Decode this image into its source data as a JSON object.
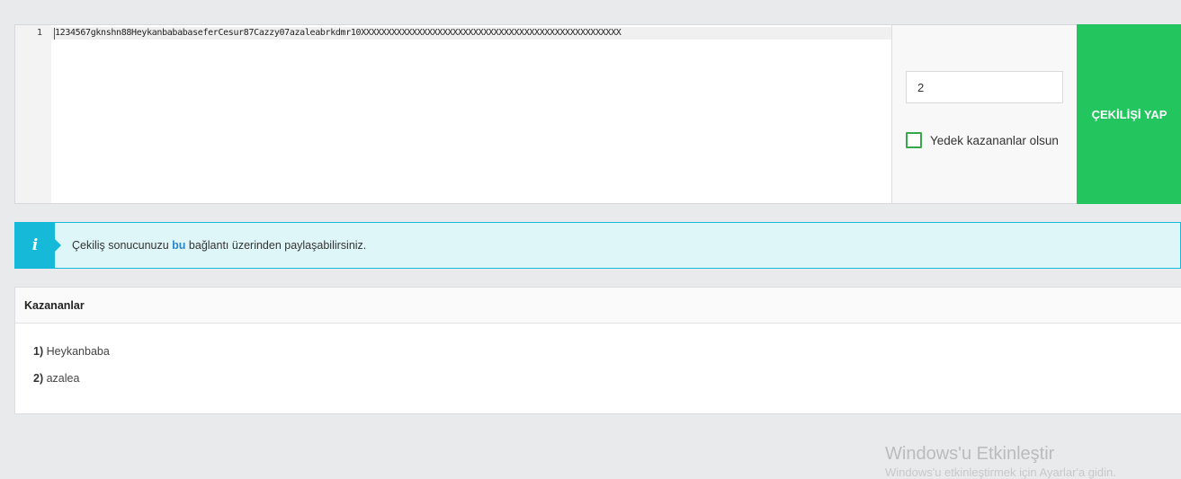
{
  "editor": {
    "line_number": "1",
    "line_text": "1234567gknshn88HeykanbababaseferCesur87Cazzy07azaleabrkdmr10XXXXXXXXXXXXXXXXXXXXXXXXXXXXXXXXXXXXXXXXXXXXXXXXXXX"
  },
  "controls": {
    "winner_count_value": "2",
    "backup_checkbox_label": "Yedek kazananlar olsun",
    "backup_checked": false,
    "draw_button_label": "ÇEKİLİŞİ YAP",
    "draw_button_color": "#22c55e"
  },
  "info": {
    "icon": "info-icon",
    "icon_glyph": "i",
    "text_before": "Çekiliş sonucunuzu ",
    "link_text": "bu",
    "text_after": " bağlantı üzerinden paylaşabilirsiniz.",
    "color": "#16b9d8"
  },
  "winners": {
    "title": "Kazananlar",
    "items": [
      {
        "num": "1)",
        "name": "Heykanbaba"
      },
      {
        "num": "2)",
        "name": "azalea"
      }
    ]
  },
  "watermark": {
    "title": "Windows'u Etkinleştir",
    "subtitle": "Windows'u etkinleştirmek için Ayarlar'a gidin."
  }
}
